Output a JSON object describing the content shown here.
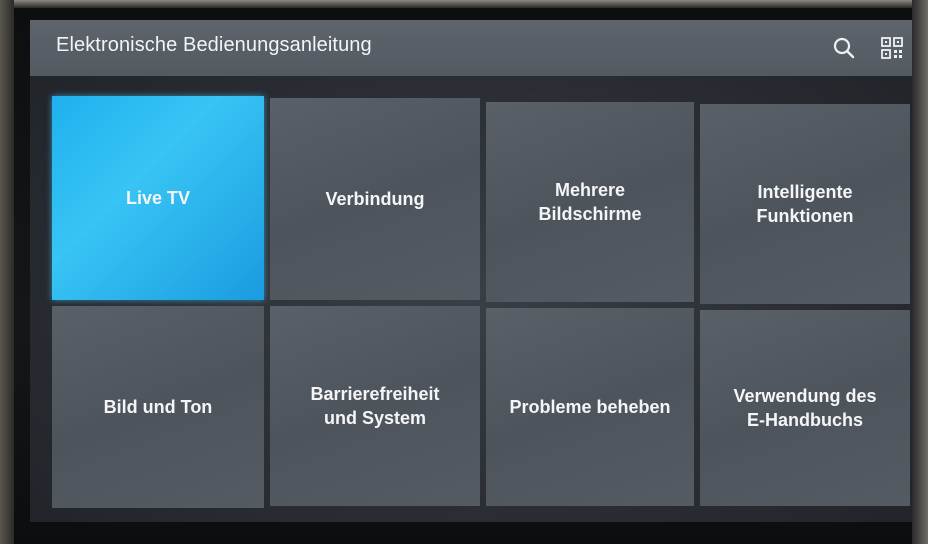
{
  "header": {
    "title": "Elektronische Bedienungsanleitung",
    "search_icon": "search-icon",
    "qr_icon": "qr-code-icon"
  },
  "tiles": [
    {
      "label": "Live TV",
      "focused": true
    },
    {
      "label": "Verbindung",
      "focused": false
    },
    {
      "label": "Mehrere\nBildschirme",
      "focused": false
    },
    {
      "label": "Intelligente\nFunktionen",
      "focused": false
    },
    {
      "label": "Bild und Ton",
      "focused": false
    },
    {
      "label": "Barrierefreiheit\nund System",
      "focused": false
    },
    {
      "label": "Probleme beheben",
      "focused": false
    },
    {
      "label": "Verwendung des\nE-Handbuchs",
      "focused": false
    }
  ],
  "colors": {
    "focus": "#2bbcf2",
    "tile": "#555b63",
    "header": "#5a6068"
  }
}
